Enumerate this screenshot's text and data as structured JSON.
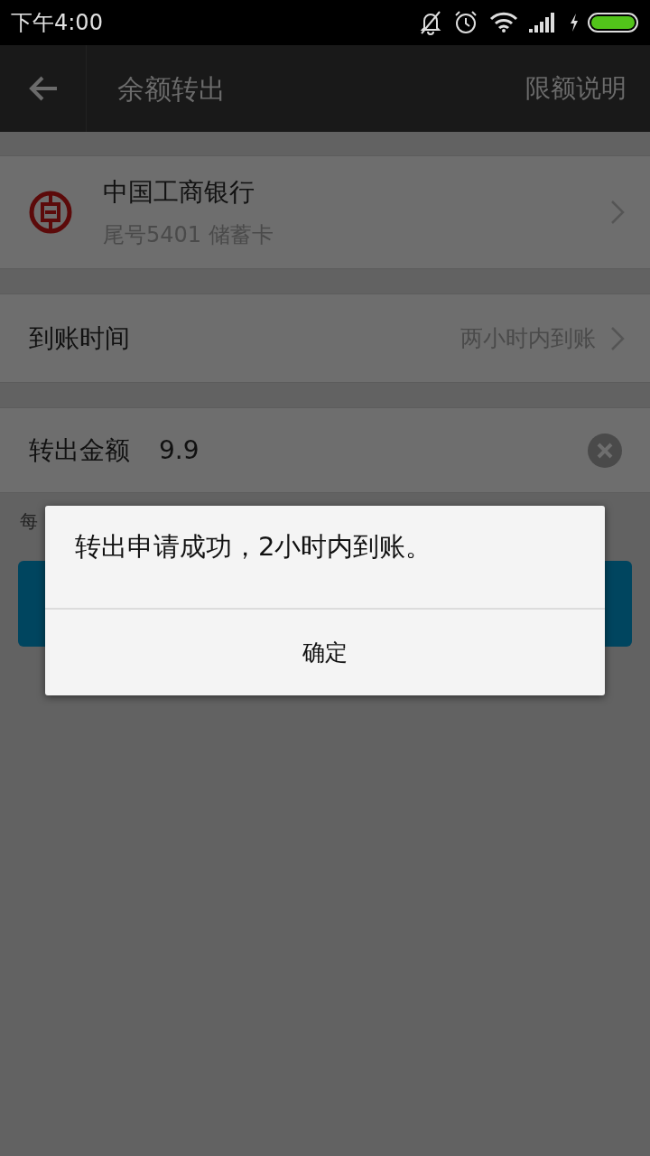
{
  "status_bar": {
    "time": "下午4:00"
  },
  "header": {
    "title": "余额转出",
    "action": "限额说明"
  },
  "bank": {
    "name": "中国工商银行",
    "detail": "尾号5401 储蓄卡"
  },
  "arrival": {
    "label": "到账时间",
    "value": "两小时内到账"
  },
  "amount": {
    "label": "转出金额",
    "value": "9.9"
  },
  "note": "每",
  "dialog": {
    "message": "转出申请成功，2小时内到账。",
    "button": "确定"
  }
}
